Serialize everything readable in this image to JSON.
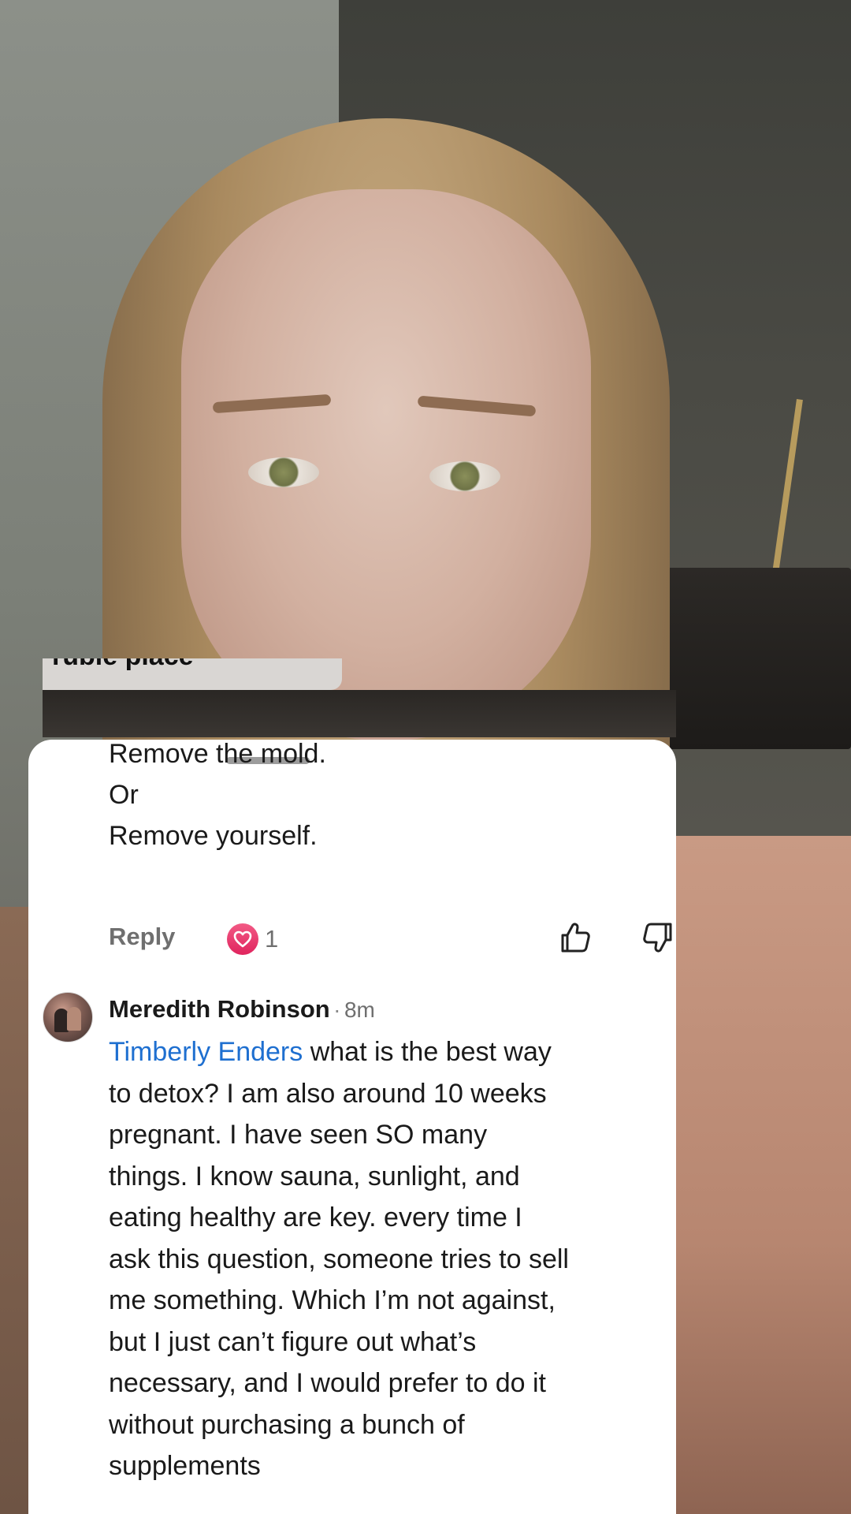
{
  "previous_comment": {
    "lines": [
      "Remove the mold.",
      "Or",
      "Remove yourself."
    ],
    "reply_label": "Reply",
    "like_count": "1"
  },
  "comment": {
    "author": "Meredith Robinson",
    "separator": "·",
    "time": "8m",
    "mention": "Timberly Enders",
    "lines": [
      " what is the best way",
      "to detox?  I am also around 10 weeks",
      "pregnant.  I have seen SO many",
      "things.  I know sauna, sunlight, and",
      "eating healthy are key.  every time I",
      "ask this question, someone tries to sell",
      "me something.  Which I’m not against,",
      "but I just can’t figure out what’s",
      "necessary, and I would prefer to do it",
      "without purchasing a bunch of",
      "supplements"
    ]
  },
  "icons": {
    "heart": "heart-icon",
    "thumbs_up": "thumbs-up-icon",
    "thumbs_down": "thumbs-down-icon",
    "drag_handle": "drag-handle"
  },
  "colors": {
    "mention": "#1e6fd0",
    "heart": "#e0245e",
    "sheet": "#ffffff"
  }
}
